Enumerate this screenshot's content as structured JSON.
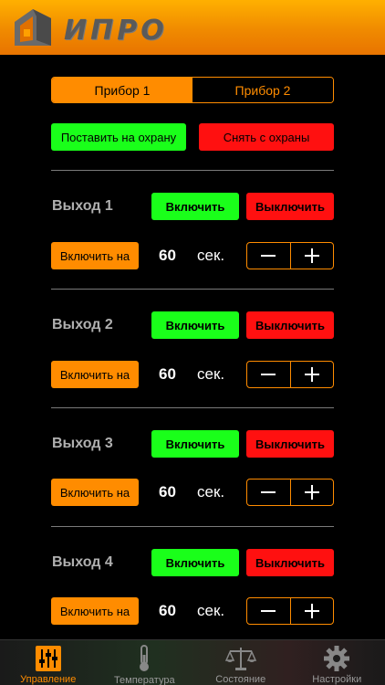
{
  "header": {
    "logo_text": "ИПРО"
  },
  "devices": {
    "tabs": [
      {
        "label": "Прибор 1",
        "active": true
      },
      {
        "label": "Прибор 2",
        "active": false
      }
    ]
  },
  "security": {
    "arm_label": "Поставить на охрану",
    "disarm_label": "Снять с охраны"
  },
  "outputs": [
    {
      "name": "Выход 1",
      "on_label": "Включить",
      "off_label": "Выключить",
      "timer_label": "Включить на",
      "seconds": "60",
      "unit": "сек."
    },
    {
      "name": "Выход 2",
      "on_label": "Включить",
      "off_label": "Выключить",
      "timer_label": "Включить на",
      "seconds": "60",
      "unit": "сек."
    },
    {
      "name": "Выход 3",
      "on_label": "Включить",
      "off_label": "Выключить",
      "timer_label": "Включить на",
      "seconds": "60",
      "unit": "сек."
    },
    {
      "name": "Выход 4",
      "on_label": "Включить",
      "off_label": "Выключить",
      "timer_label": "Включить на",
      "seconds": "60",
      "unit": "сек."
    }
  ],
  "tabbar": [
    {
      "label": "Управление",
      "icon": "sliders-icon",
      "active": true
    },
    {
      "label": "Температура",
      "icon": "thermometer-icon",
      "active": false
    },
    {
      "label": "Состояние",
      "icon": "scales-icon",
      "active": false
    },
    {
      "label": "Настройки",
      "icon": "gear-icon",
      "active": false
    }
  ],
  "colors": {
    "accent": "#ff8c00",
    "on": "#1aff1a",
    "off": "#ff1010"
  }
}
